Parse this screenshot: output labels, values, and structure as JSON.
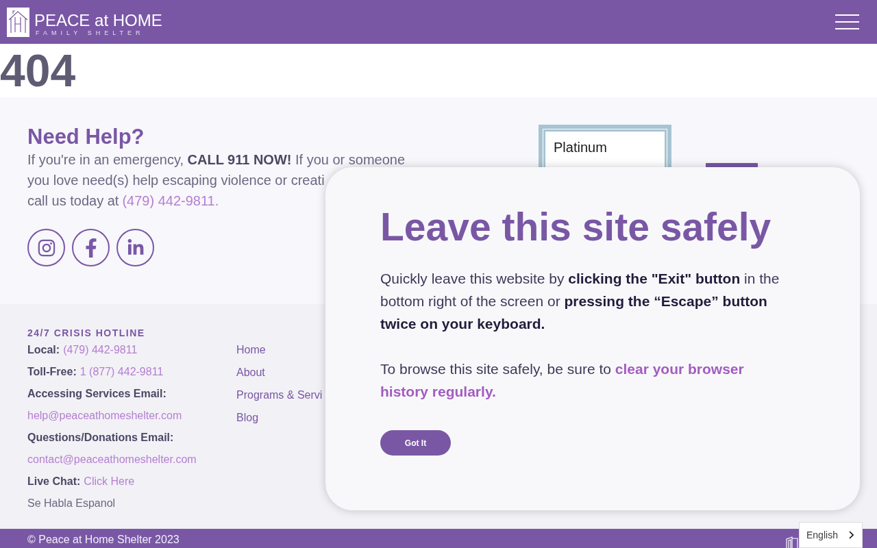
{
  "header": {
    "logo_title": "PEACE at HOME",
    "logo_tagline": "FAMILY SHELTER"
  },
  "error_code": "404",
  "help": {
    "title": "Need Help?",
    "lines": [
      "If you're in an emergency, **CALL 911 NOW!** If you or someone",
      "you love need(s) help escaping violence or creati",
      "call us today at"
    ],
    "phone_link": "(479) 442-9811.",
    "socials": [
      {
        "kind": "instagram"
      },
      {
        "kind": "facebook"
      },
      {
        "kind": "linkedin"
      }
    ]
  },
  "badge": {
    "text": "Platinum"
  },
  "footer": {
    "hotline_title": "24/7 CRISIS HOTLINE",
    "contacts": [
      {
        "kind": "field",
        "label": "Local:",
        "value": "(479) 442-9811"
      },
      {
        "kind": "field",
        "label": "Toll-Free:",
        "value": "1 (877) 442-9811"
      },
      {
        "kind": "label",
        "text": "Accessing Services Email:"
      },
      {
        "kind": "link",
        "text": "help@peaceathomeshelter.com"
      },
      {
        "kind": "label",
        "text": "Questions/Donations Email:"
      },
      {
        "kind": "link",
        "text": "contact@peaceathomeshelter.com"
      },
      {
        "kind": "field",
        "label": "Live Chat:",
        "value": "Click Here"
      },
      {
        "kind": "text",
        "text": "Se Habla Espanol"
      }
    ],
    "nav": [
      "Home",
      "About",
      "Programs & Servi",
      "Blog"
    ]
  },
  "copyright": "© Peace at Home Shelter 2023",
  "language": "English",
  "modal": {
    "title": "Leave this site safely",
    "body": "Quickly leave this website by **clicking the \"Exit\" button** in the bottom right of the screen or **pressing the “Escape” button twice on your keyboard.**",
    "tip": "To browse this site safely, be sure to **clear your browser history regularly.**",
    "button": "Got It"
  }
}
